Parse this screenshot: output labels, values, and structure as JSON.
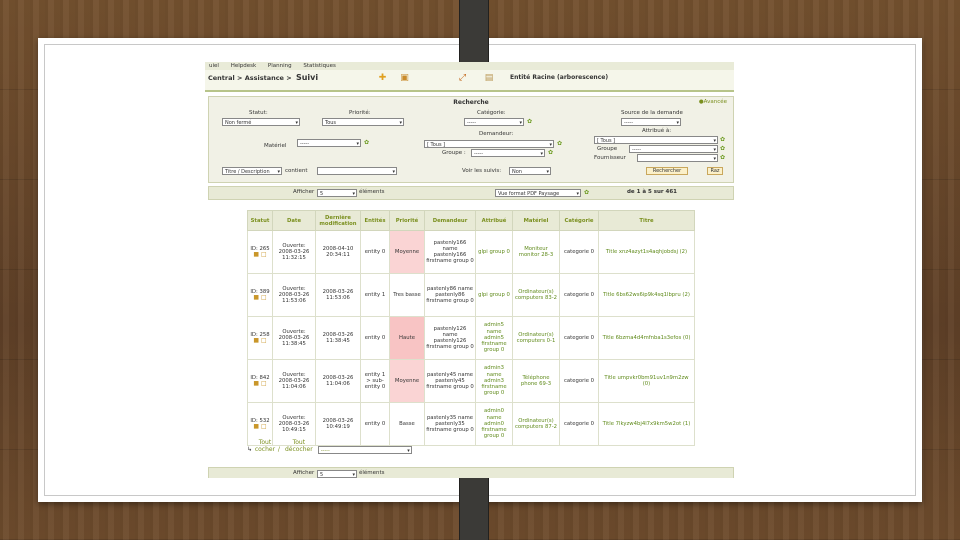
{
  "menubar": {
    "items": [
      "uiel",
      "Helpdesk",
      "Planning",
      "Statistiques"
    ]
  },
  "header": {
    "crumb1": "Central >",
    "crumb2": "Assistance >",
    "crumb3": "Suivi",
    "entity": "Entité Racine (arborescence)"
  },
  "search": {
    "title": "Recherche",
    "advanced": "Avancée",
    "status_label": "Statut:",
    "status_value": "Non fermé",
    "priority_label": "Priorité:",
    "priority_value": "Tous",
    "category_label": "Catégorie:",
    "category_value": "-----",
    "source_label": "Source de la demande",
    "source_value": "-----",
    "assigned_label": "Attribué à:",
    "assigned_value": "[ Tous ]",
    "group_label1": "Groupe",
    "group_value1": "-----",
    "supplier_label": "Fournisseur",
    "supplier_value": "",
    "material_label": "Matériel",
    "material_value": "-----",
    "requester_label": "Demandeur:",
    "requester_value": "[ Tous ]",
    "group_label2": "Groupe :",
    "group_value2": "-----",
    "title_select": "Titre / Description",
    "contains_label": "contient",
    "contains_value": "",
    "followups_label": "Voir les suivis:",
    "followups_value": "Non",
    "search_button": "Rechercher",
    "reset_button": "Raz"
  },
  "pager": {
    "show_label": "Afficher",
    "show_value": "5",
    "items_label": "éléments",
    "export_value": "Vue format PDF Paysage",
    "range": "de 1 à 5 sur 461"
  },
  "table": {
    "headers": [
      "Statut",
      "Date",
      "Dernière modification",
      "Entités",
      "Priorité",
      "Demandeur",
      "Attribué",
      "Matériel",
      "Catégorie",
      "Titre"
    ],
    "rows": [
      {
        "id": "ID: 265",
        "date": "Ouverte: 2008-03-26 11:32:15",
        "modified": "2008-04-10 20:34:11",
        "entity": "entity 0",
        "priority": "Moyenne",
        "prio_class": "prio-mid",
        "requester": "pastenly166 name pastenly166 firstname group 0",
        "assigned": "glpi group 0",
        "material": "Moniteur monitor 28-3",
        "category": "categorie 0",
        "title": "Title xnz4azyt1s4aqhjobdsj (2)"
      },
      {
        "id": "ID: 389",
        "date": "Ouverte: 2008-03-26 11:53:06",
        "modified": "2008-03-26 11:53:06",
        "entity": "entity 1",
        "priority": "Tres basse",
        "prio_class": "prio-low",
        "requester": "pastenly86 name pastenly86 firstname group 0",
        "assigned": "glpi group 0",
        "material": "Ordinateur(s) computers 83-2",
        "category": "categorie 0",
        "title": "Title 6bs62ws6ip9k4sq1lbpru (2)"
      },
      {
        "id": "ID: 258",
        "date": "Ouverte: 2008-03-26 11:38:45",
        "modified": "2008-03-26 11:38:45",
        "entity": "entity 0",
        "priority": "Haute",
        "prio_class": "prio-hi",
        "requester": "pastenly126 name pastenly126 firstname group 0",
        "assigned": "admin5 name admin5 firstname group 0",
        "material": "Ordinateur(s) computers 0-1",
        "category": "categorie 0",
        "title": "Title 6bzma4d4mfnba1s3efos (0)"
      },
      {
        "id": "ID: 842",
        "date": "Ouverte: 2008-03-26 11:04:06",
        "modified": "2008-03-26 11:04:06",
        "entity": "entity 1 > sub-entity 0",
        "priority": "Moyenne",
        "prio_class": "prio-mid",
        "requester": "pastenly45 name pastenly45 firstname group 0",
        "assigned": "admin3 name admin3 firstname group 0",
        "material": "Téléphone phone 69-3",
        "category": "categorie 0",
        "title": "Title umpvkr0bm91uv1n9m2zw (0)"
      },
      {
        "id": "ID: 532",
        "date": "Ouverte: 2008-03-26 10:49:15",
        "modified": "2008-03-26 10:49:19",
        "entity": "entity 0",
        "priority": "Basse",
        "prio_class": "prio-low",
        "requester": "pastenly35 name pastenly35 firstname group 0",
        "assigned": "admin0 name admin0 firstname group 0",
        "material": "Ordinateur(s) computers 87-2",
        "category": "categorie 0",
        "title": "Title 7lkyzw4bj4l7x9km5w2ot (1)"
      }
    ]
  },
  "actions": {
    "check_all": "Tout cocher",
    "uncheck_all": "Tout décocher",
    "action_value": "-----"
  },
  "pager_bottom": {
    "show_label": "Afficher",
    "show_value": "5",
    "items_label": "éléments"
  },
  "colors": {
    "accent": "#7a8f1e",
    "high_priority": "#f8c4c4",
    "medium_priority": "#fad4d4"
  }
}
